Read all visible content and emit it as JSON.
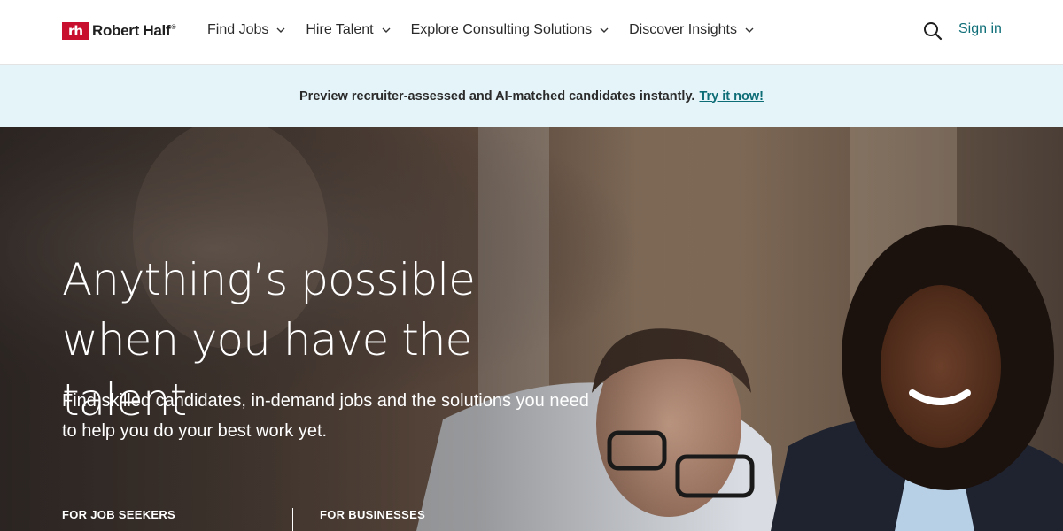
{
  "header": {
    "logo_mark": "rh",
    "logo_text": "Robert Half",
    "logo_reg": "®",
    "nav": [
      {
        "label": "Find Jobs"
      },
      {
        "label": "Hire Talent"
      },
      {
        "label": "Explore Consulting Solutions"
      },
      {
        "label": "Discover Insights"
      }
    ],
    "sign_in": "Sign in"
  },
  "banner": {
    "text": "Preview recruiter-assessed and AI-matched candidates instantly.",
    "link": "Try it now!"
  },
  "hero": {
    "title": "Anything’s possible when you have the talent",
    "subtitle": "Find skilled candidates, in-demand jobs and the solutions you need to help you do your best work yet.",
    "col_left": "FOR JOB SEEKERS",
    "col_right": "FOR BUSINESSES"
  },
  "colors": {
    "brand": "#c8102e",
    "link": "#0d6d77",
    "banner_bg": "#e5f4f8"
  }
}
